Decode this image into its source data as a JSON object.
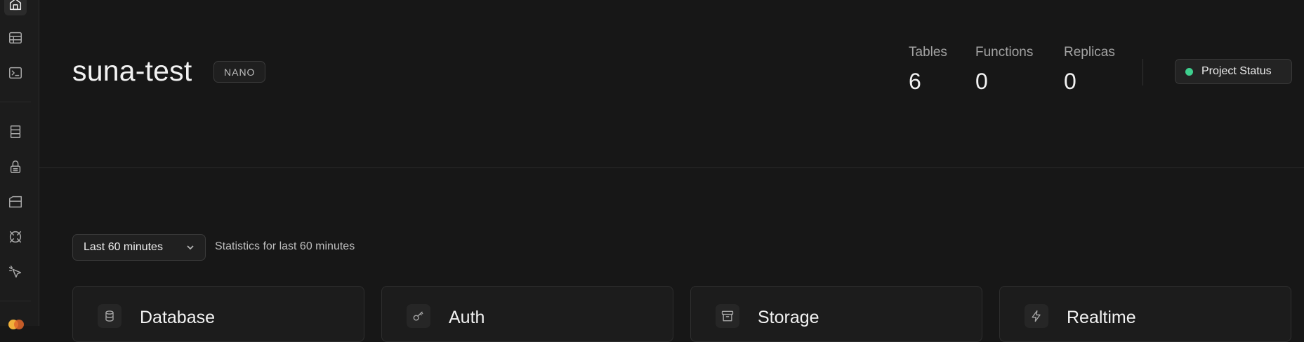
{
  "project": {
    "name": "suna-test",
    "tier": "NANO"
  },
  "stats": [
    {
      "label": "Tables",
      "value": "6"
    },
    {
      "label": "Functions",
      "value": "0"
    },
    {
      "label": "Replicas",
      "value": "0"
    }
  ],
  "status_button": {
    "label": "Project Status",
    "dot_color": "#3ecf8e"
  },
  "filter": {
    "selected": "Last 60 minutes",
    "description": "Statistics for last 60 minutes"
  },
  "cards": [
    {
      "title": "Database",
      "icon": "database-icon"
    },
    {
      "title": "Auth",
      "icon": "key-icon"
    },
    {
      "title": "Storage",
      "icon": "archive-icon"
    },
    {
      "title": "Realtime",
      "icon": "bolt-icon"
    }
  ],
  "sidebar": {
    "icons": [
      "home-icon",
      "table-editor-icon",
      "sql-editor-icon",
      "database-icon",
      "auth-lock-icon",
      "storage-folder-icon",
      "edge-functions-icon",
      "advisor-pointer-icon"
    ]
  },
  "colors": {
    "background": "#171717",
    "accent": "#3ecf8e"
  }
}
